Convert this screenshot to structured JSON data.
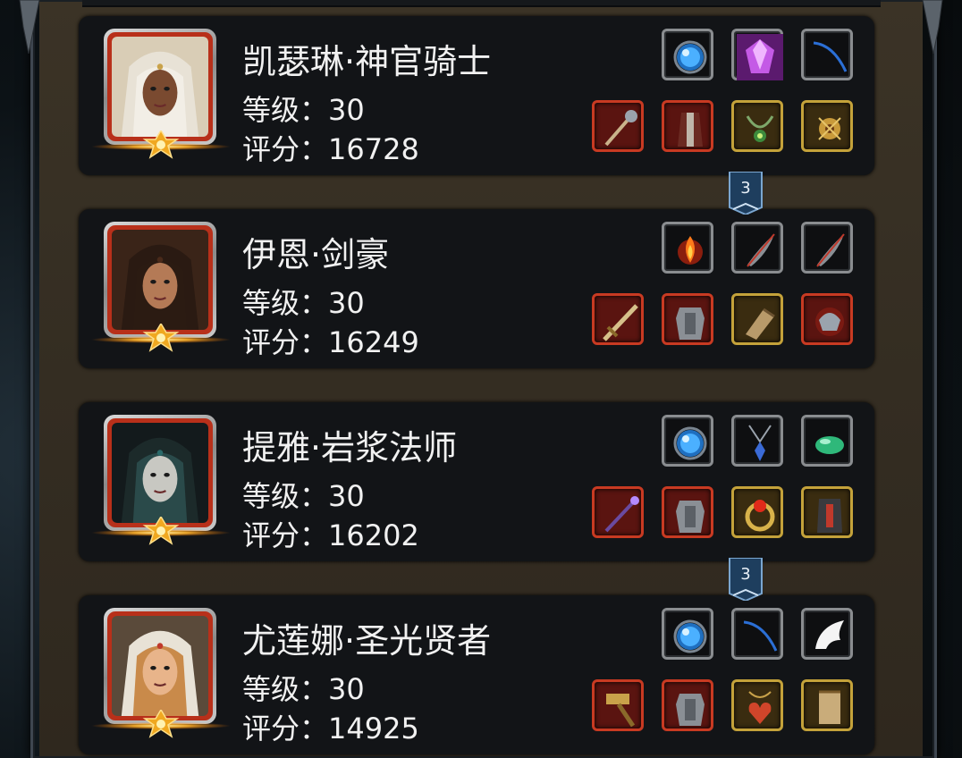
{
  "heroes": [
    {
      "name": "凯瑟琳·神官骑士",
      "level_label": "等级：30",
      "score_label": "评分：16728",
      "portrait": "priest-knight-portrait",
      "equip_top": [
        {
          "frame": "grey",
          "icon": "blue-orb-icon"
        },
        {
          "frame": "grey",
          "icon": "purple-gem-icon"
        },
        {
          "frame": "grey",
          "icon": "blue-string-icon"
        }
      ],
      "equip_bottom": [
        {
          "frame": "red",
          "icon": "mace-icon"
        },
        {
          "frame": "red",
          "icon": "robe-armor-icon"
        },
        {
          "frame": "gold",
          "icon": "necklace-icon"
        },
        {
          "frame": "gold",
          "icon": "gold-amulet-icon"
        }
      ]
    },
    {
      "name": "伊恩·剑豪",
      "level_label": "等级：30",
      "score_label": "评分：16249",
      "portrait": "swordmaster-portrait",
      "equip_top": [
        {
          "frame": "grey",
          "icon": "fire-emblem-icon"
        },
        {
          "frame": "grey",
          "icon": "feather-icon"
        },
        {
          "frame": "grey",
          "icon": "feather-icon"
        }
      ],
      "equip_bottom": [
        {
          "frame": "red",
          "icon": "sword-icon"
        },
        {
          "frame": "red",
          "icon": "plate-armor-icon"
        },
        {
          "frame": "gold",
          "icon": "gauntlet-icon"
        },
        {
          "frame": "red",
          "icon": "pauldron-icon"
        }
      ]
    },
    {
      "name": "提雅·岩浆法师",
      "level_label": "等级：30",
      "score_label": "评分：16202",
      "portrait": "lava-mage-portrait",
      "equip_top": [
        {
          "frame": "grey",
          "icon": "blue-orb-icon"
        },
        {
          "frame": "grey",
          "icon": "pendant-icon"
        },
        {
          "frame": "grey",
          "icon": "green-stone-icon"
        }
      ],
      "equip_bottom": [
        {
          "frame": "red",
          "icon": "staff-icon"
        },
        {
          "frame": "red",
          "icon": "plate-armor-icon"
        },
        {
          "frame": "gold",
          "icon": "ruby-ring-icon"
        },
        {
          "frame": "gold",
          "icon": "dark-armor-icon"
        }
      ]
    },
    {
      "name": "尤莲娜·圣光贤者",
      "level_label": "等级：30",
      "score_label": "评分：14925",
      "portrait": "holy-sage-portrait",
      "equip_top": [
        {
          "frame": "grey",
          "icon": "blue-orb-icon"
        },
        {
          "frame": "grey",
          "icon": "blue-string-icon"
        },
        {
          "frame": "grey",
          "icon": "white-wing-icon"
        }
      ],
      "equip_bottom": [
        {
          "frame": "red",
          "icon": "hammer-icon"
        },
        {
          "frame": "red",
          "icon": "plate-armor-icon"
        },
        {
          "frame": "gold",
          "icon": "heart-amulet-icon"
        },
        {
          "frame": "gold",
          "icon": "scroll-icon"
        }
      ]
    }
  ],
  "link_badges": [
    "3",
    "3"
  ],
  "colors": {
    "panel": "#342d22",
    "card": "#121417",
    "slot_red": "#c83a22",
    "slot_gold": "#c4a23a",
    "slot_grey": "#8a8d90",
    "badge": "#1e3e5e"
  }
}
